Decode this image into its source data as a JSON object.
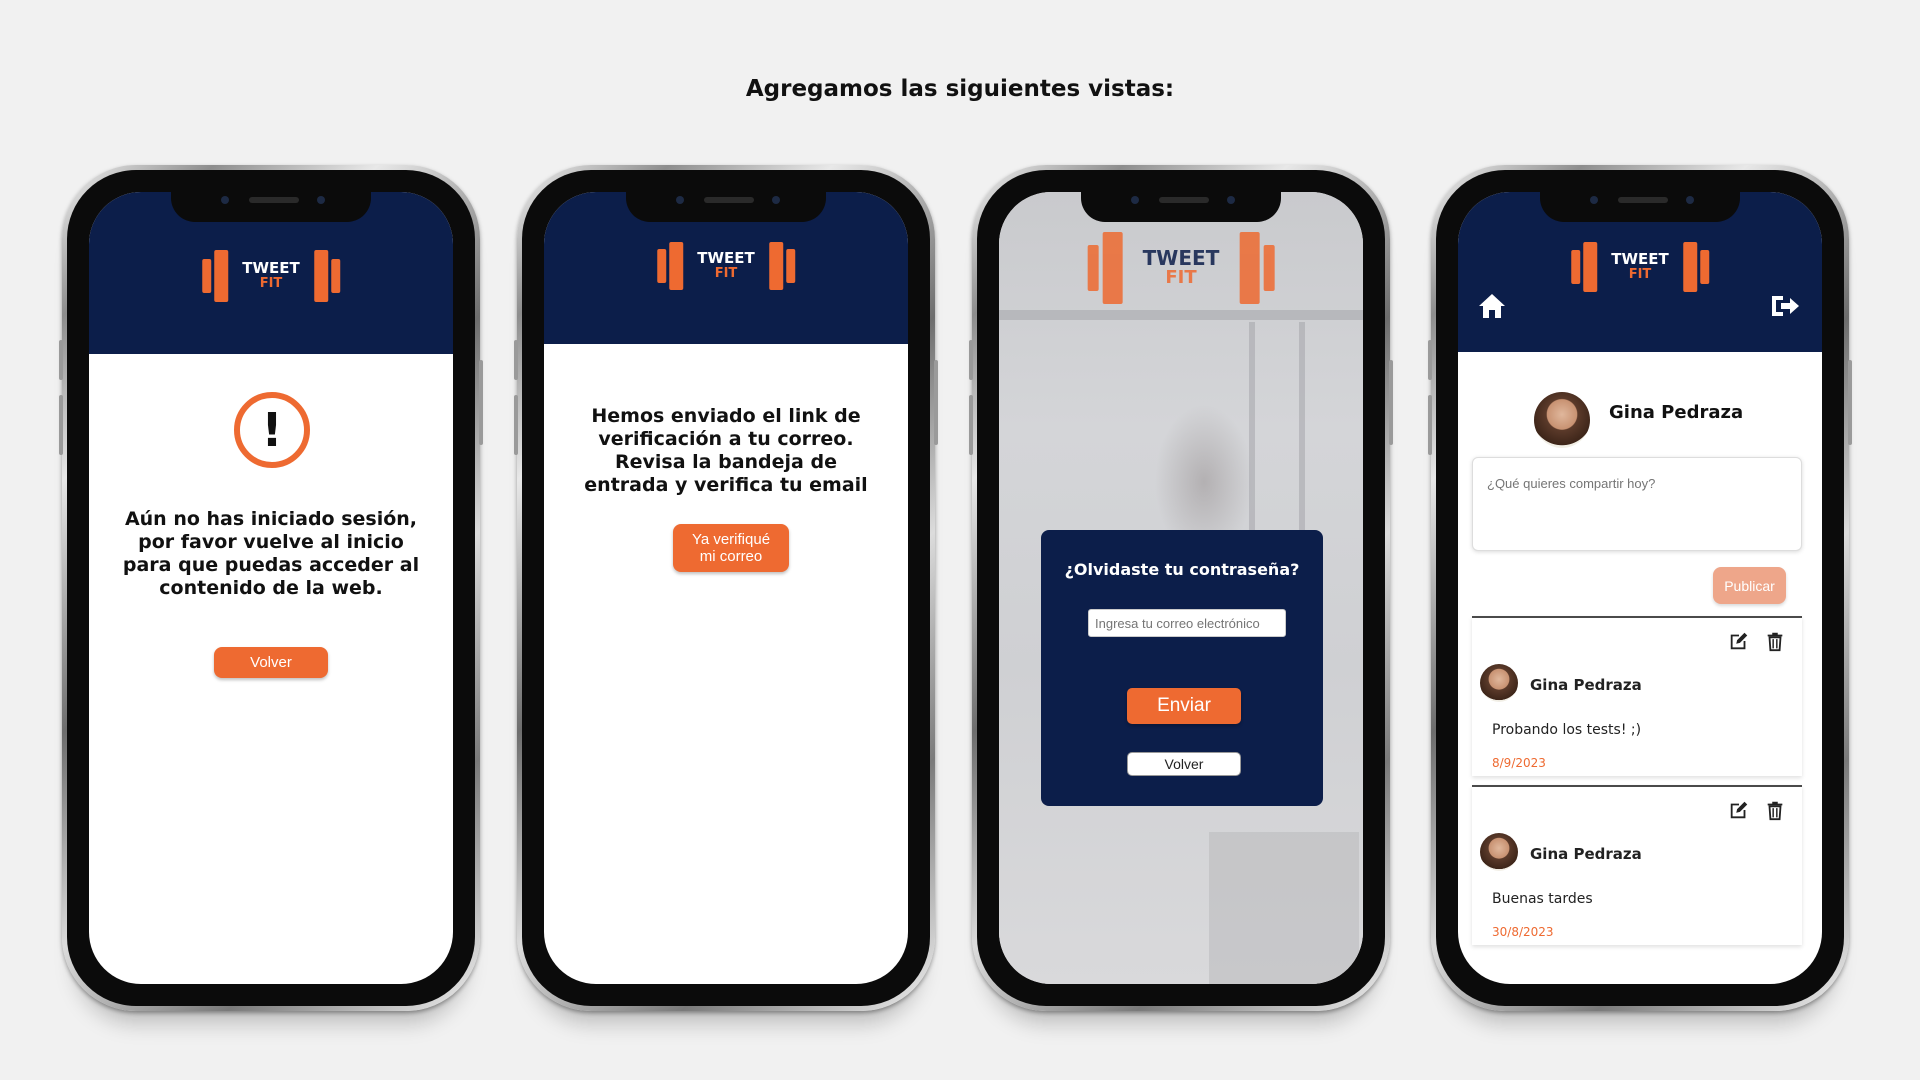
{
  "page": {
    "title": "Agregamos las siguientes vistas:"
  },
  "brand": {
    "word1": "TWEET",
    "word2": "FIT"
  },
  "colors": {
    "navy": "#0c1e4a",
    "orange": "#ee6a31",
    "background": "#f1f1f1"
  },
  "not_logged": {
    "message": "Aún no has iniciado sesión, por favor vuelve al inicio para que puedas acceder al contenido de la web.",
    "button": "Volver",
    "icon": "exclamation-circle-icon"
  },
  "verification": {
    "message": "Hemos enviado el link de verificación a tu correo. Revisa la bandeja de entrada y verifica tu email",
    "button_line1": "Ya verifiqué",
    "button_line2": "mi correo"
  },
  "forgot": {
    "title": "¿Olvidaste tu contraseña?",
    "email_placeholder": "Ingresa tu correo electrónico",
    "send_button": "Enviar",
    "back_button": "Volver"
  },
  "feed": {
    "user_name": "Gina Pedraza",
    "composer_placeholder": "¿Qué quieres compartir hoy?",
    "publish_button": "Publicar",
    "posts": [
      {
        "author": "Gina Pedraza",
        "text": "Probando los tests! ;)",
        "date": "8/9/2023"
      },
      {
        "author": "Gina Pedraza",
        "text": "Buenas tardes",
        "date": "30/8/2023"
      }
    ],
    "icons": [
      "home-icon",
      "logout-icon",
      "edit-icon",
      "trash-icon"
    ]
  }
}
